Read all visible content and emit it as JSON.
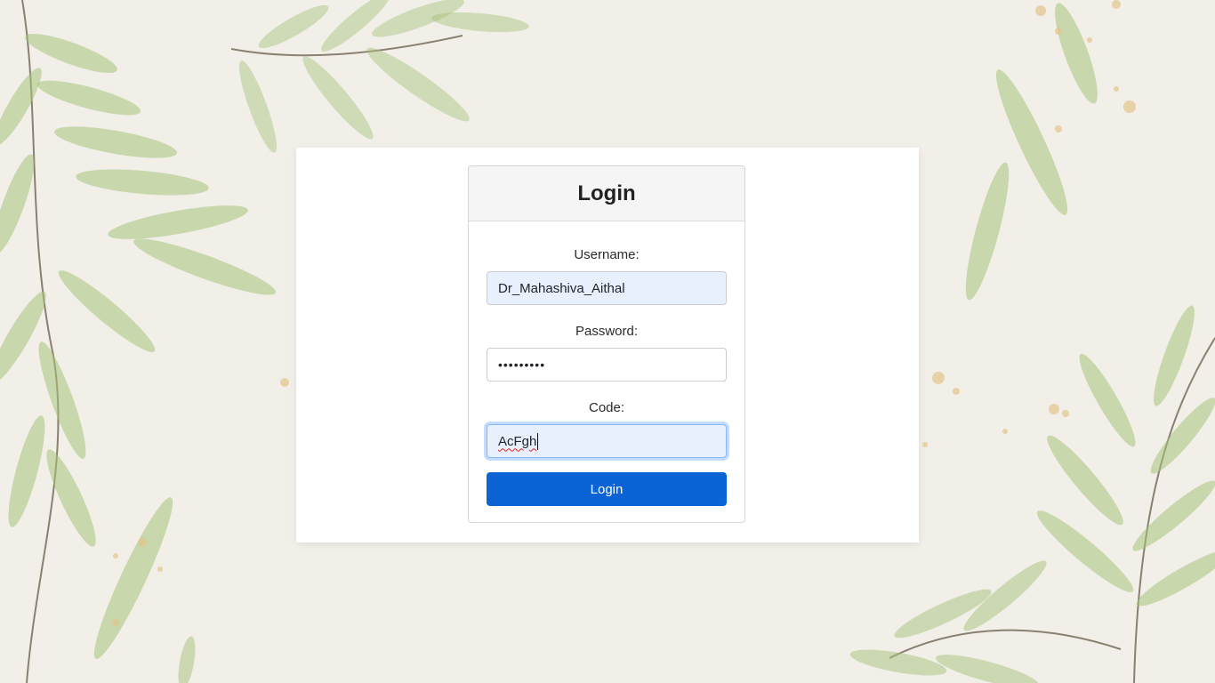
{
  "login": {
    "title": "Login",
    "username_label": "Username:",
    "username_value": "Dr_Mahashiva_Aithal",
    "password_label": "Password:",
    "password_value": "•••••••••",
    "code_label": "Code:",
    "code_value": "AcFgh",
    "submit_label": "Login"
  },
  "colors": {
    "button": "#0b63d6",
    "autofill_bg": "#e8f0fe",
    "page_bg": "#f1efe8",
    "leaf": "#9bb867"
  },
  "icons": {
    "background": "watercolor-leaves-decoration"
  }
}
